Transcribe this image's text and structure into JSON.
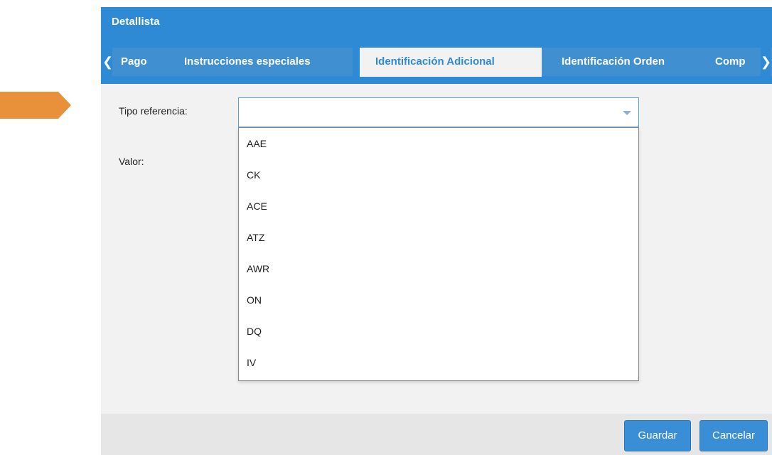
{
  "dialog": {
    "title": "Detallista",
    "tabs": [
      {
        "label": "Pago",
        "active": false
      },
      {
        "label": "Instrucciones especiales",
        "active": false
      },
      {
        "label": "Identificación Adicional",
        "active": true
      },
      {
        "label": "Identificación Orden",
        "active": false
      },
      {
        "label": "Comp",
        "active": false
      }
    ],
    "tab_scroll_left_icon": "chevron-left-icon",
    "tab_scroll_right_icon": "chevron-right-icon"
  },
  "form": {
    "tipo_referencia_label": "Tipo referencia:",
    "tipo_referencia_value": "",
    "valor_label": "Valor:",
    "options": [
      "AAE",
      "CK",
      "ACE",
      "ATZ",
      "AWR",
      "ON",
      "DQ",
      "IV"
    ]
  },
  "footer": {
    "save_label": "Guardar",
    "cancel_label": "Cancelar"
  },
  "colors": {
    "header_blue": "#2f8ad6",
    "marker_orange": "#e8913a"
  }
}
